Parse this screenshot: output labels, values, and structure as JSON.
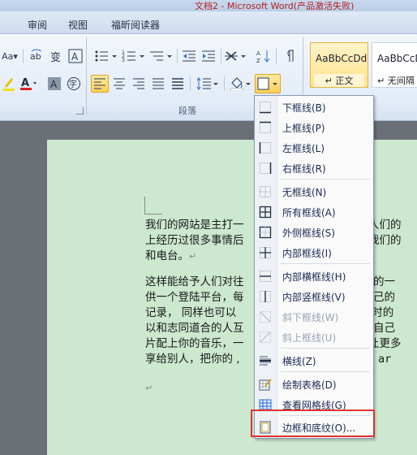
{
  "window": {
    "title": "文档2 - Microsoft Word(产品激活失败)"
  },
  "tabs": [
    "审阅",
    "视图",
    "福昕阅读器"
  ],
  "ribbon": {
    "paragraph_group_label": "段落",
    "styles": [
      {
        "sample": "AaBbCcDd",
        "name": "↵ 正文"
      },
      {
        "sample": "AaBbCcDc",
        "name": "↵ 无间隔"
      }
    ],
    "font_size_btn": "Aa▾",
    "char_btn": "A"
  },
  "document": {
    "paragraph_1": [
      "我们的网站是主打一",
      "上经历过很多事情后",
      "和电台。"
    ],
    "paragraph_1_right": [
      "据人们的",
      "后我们的"
    ],
    "paragraph_2": [
      "这样能给予人们对往",
      "供一个登陆平台，每",
      "记录，  同样也可以",
      "以和志同道合的人互",
      "片配上你的音乐，一",
      "享给别人，把你的 ,"
    ],
    "paragraph_2_right": [
      "时的一",
      "自己的",
      "路上时的",
      "于自己",
      "们让更多",
      "We ar"
    ]
  },
  "border_menu": {
    "items": [
      {
        "label": "下框线(B)",
        "icon": "bottom-border-icon",
        "disabled": false
      },
      {
        "label": "上框线(P)",
        "icon": "top-border-icon",
        "disabled": false
      },
      {
        "label": "左框线(L)",
        "icon": "left-border-icon",
        "disabled": false
      },
      {
        "label": "右框线(R)",
        "icon": "right-border-icon",
        "disabled": false
      },
      {
        "label": "无框线(N)",
        "icon": "no-border-icon",
        "disabled": false
      },
      {
        "label": "所有框线(A)",
        "icon": "all-borders-icon",
        "disabled": false
      },
      {
        "label": "外侧框线(S)",
        "icon": "outside-borders-icon",
        "disabled": false
      },
      {
        "label": "内部框线(I)",
        "icon": "inside-borders-icon",
        "disabled": false
      },
      {
        "label": "内部横框线(H)",
        "icon": "inside-horizontal-border-icon",
        "disabled": false
      },
      {
        "label": "内部竖框线(V)",
        "icon": "inside-vertical-border-icon",
        "disabled": false
      },
      {
        "label": "斜下框线(W)",
        "icon": "diagonal-down-border-icon",
        "disabled": true
      },
      {
        "label": "斜上框线(U)",
        "icon": "diagonal-up-border-icon",
        "disabled": true
      },
      {
        "label": "横线(Z)",
        "icon": "horizontal-line-icon",
        "disabled": false
      },
      {
        "label": "绘制表格(D)",
        "icon": "draw-table-icon",
        "disabled": false
      },
      {
        "label": "查看网格线(G)",
        "icon": "view-gridlines-icon",
        "disabled": false
      },
      {
        "label": "边框和底纹(O)...",
        "icon": "borders-and-shading-icon",
        "disabled": false
      }
    ]
  },
  "colors": {
    "highlight": "#e03131",
    "page_bg": "#cce8cf",
    "title_text": "#b5201f"
  }
}
